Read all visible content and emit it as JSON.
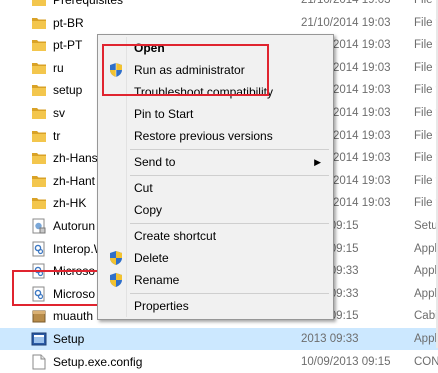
{
  "files": [
    {
      "name": "Prerequisites",
      "date": "21/10/2014 19:03",
      "type": "File fo",
      "icon": "folder-icon"
    },
    {
      "name": "pt-BR",
      "date": "21/10/2014 19:03",
      "type": "File fo",
      "icon": "folder-icon"
    },
    {
      "name": "pt-PT",
      "date": "21/10/2014 19:03",
      "type": "File fo",
      "icon": "folder-icon"
    },
    {
      "name": "ru",
      "date": "21/10/2014 19:03",
      "type": "File fo",
      "icon": "folder-icon"
    },
    {
      "name": "setup",
      "date": "21/10/2014 19:03",
      "type": "File fo",
      "icon": "folder-icon"
    },
    {
      "name": "sv",
      "date": "21/10/2014 19:03",
      "type": "File fo",
      "icon": "folder-icon"
    },
    {
      "name": "tr",
      "date": "21/10/2014 19:03",
      "type": "File fo",
      "icon": "folder-icon"
    },
    {
      "name": "zh-Hans",
      "date": "21/10/2014 19:03",
      "type": "File fo",
      "icon": "folder-icon"
    },
    {
      "name": "zh-Hant",
      "date": "21/10/2014 19:03",
      "type": "File fo",
      "icon": "folder-icon"
    },
    {
      "name": "zh-HK",
      "date": "21/10/2014 19:03",
      "type": "File fo",
      "icon": "folder-icon"
    },
    {
      "name": "Autorun",
      "date": "2013 09:15",
      "type": "Setup",
      "icon": "setup-info-icon"
    },
    {
      "name": "Interop.W",
      "date": "2013 09:15",
      "type": "Appl",
      "icon": "dll-icon"
    },
    {
      "name": "Microso",
      "date": "2013 09:33",
      "type": "Appl",
      "icon": "dll-icon"
    },
    {
      "name": "Microso",
      "date": "2013 09:33",
      "type": "Appl",
      "icon": "dll-icon"
    },
    {
      "name": "muauth",
      "date": "2013 09:15",
      "type": "Cabi",
      "icon": "cabinet-icon"
    },
    {
      "name": "Setup",
      "date": "2013 09:33",
      "type": "Appl",
      "icon": "setup-exe-icon",
      "selected": true
    },
    {
      "name": "Setup.exe.config",
      "date": "10/09/2013 09:15",
      "type": "CON",
      "icon": "config-file-icon"
    }
  ],
  "menu": {
    "open": "Open",
    "run_as_admin": "Run as administrator",
    "troubleshoot": "Troubleshoot compatibility",
    "pin_to_start": "Pin to Start",
    "restore_versions": "Restore previous versions",
    "send_to": "Send to",
    "send_to_arrow": "▶",
    "cut": "Cut",
    "copy": "Copy",
    "create_shortcut": "Create shortcut",
    "delete": "Delete",
    "rename": "Rename",
    "properties": "Properties"
  },
  "colors": {
    "folder": "#e8b53a",
    "selection": "#cce8ff",
    "highlight_box": "#e0242f"
  }
}
